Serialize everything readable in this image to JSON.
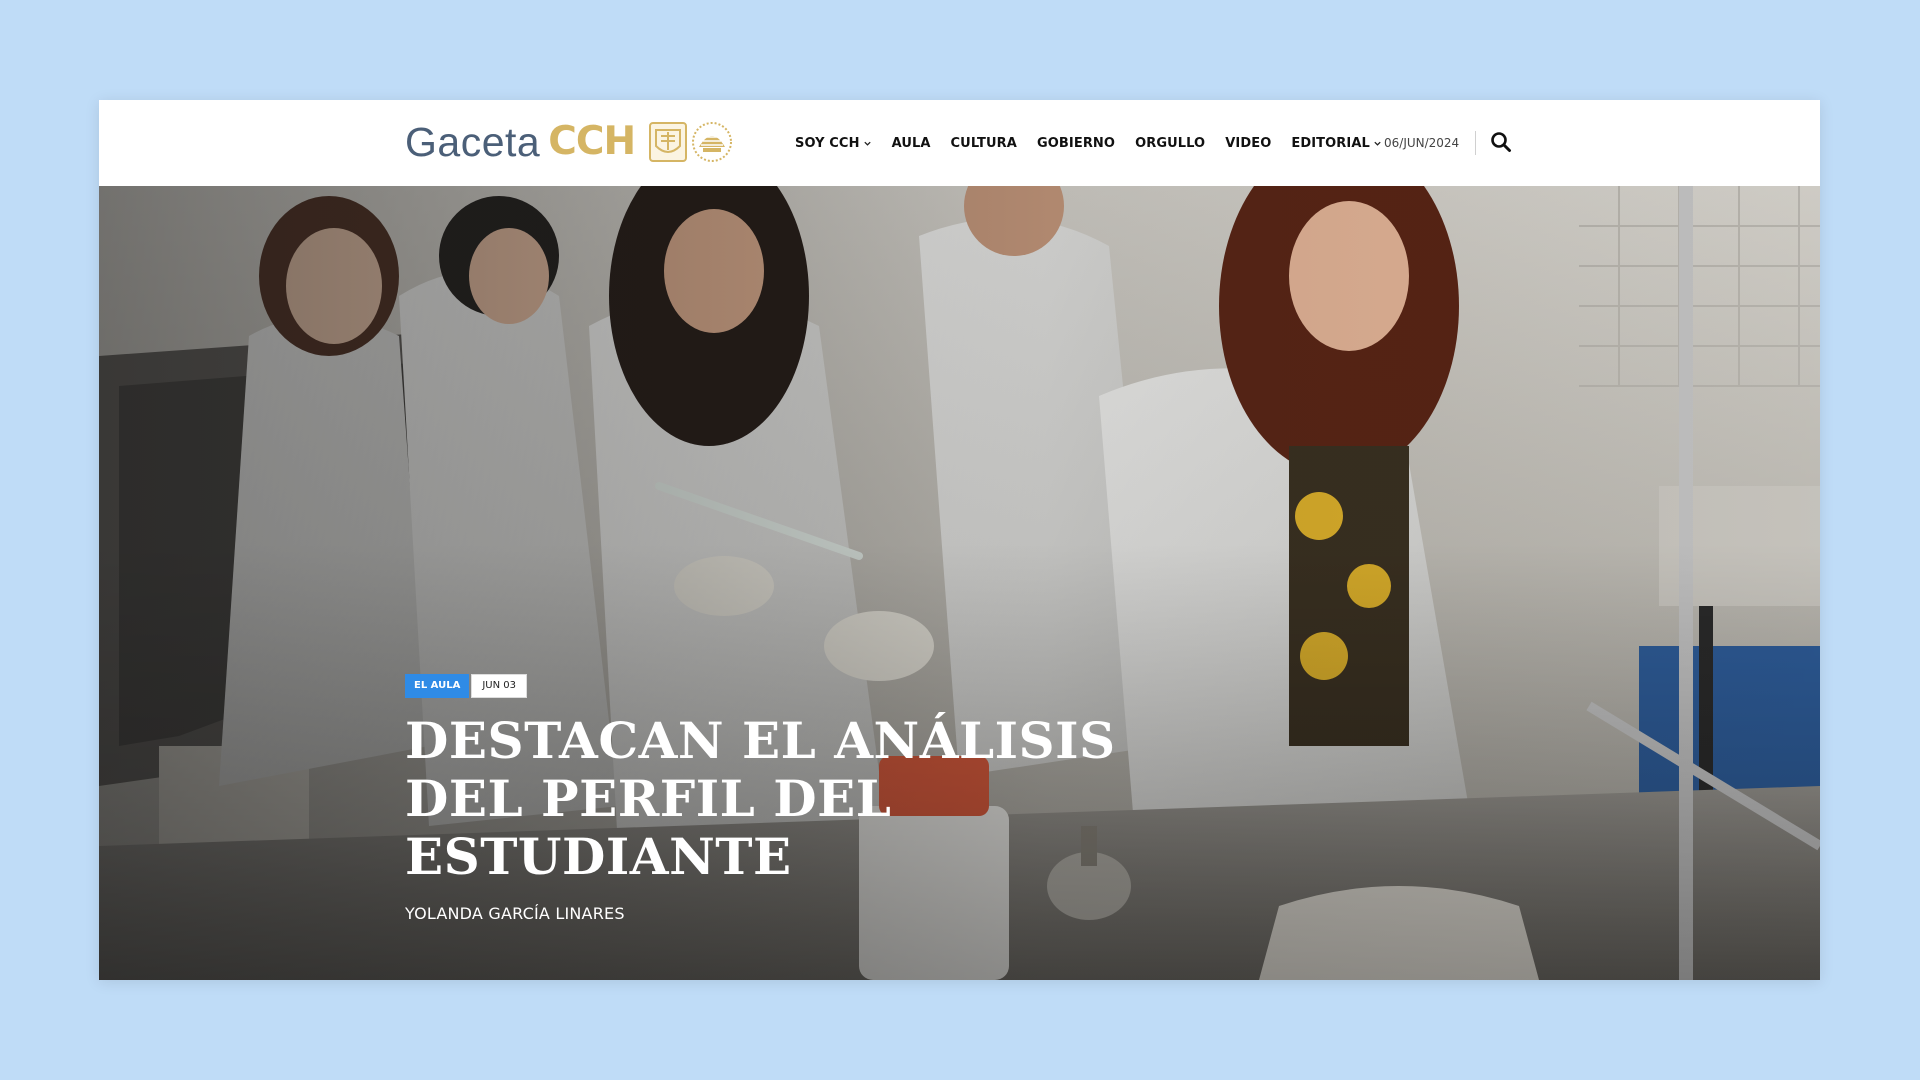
{
  "brand": {
    "word": "Gaceta",
    "mark": "CCH",
    "seal_icon": "unam-seal-icon",
    "emblem_icon": "cch-emblem-icon"
  },
  "nav": {
    "items": [
      {
        "label": "SOY CCH",
        "has_dropdown": true
      },
      {
        "label": "AULA",
        "has_dropdown": false
      },
      {
        "label": "CULTURA",
        "has_dropdown": false
      },
      {
        "label": "GOBIERNO",
        "has_dropdown": false
      },
      {
        "label": "ORGULLO",
        "has_dropdown": false
      },
      {
        "label": "VIDEO",
        "has_dropdown": false
      },
      {
        "label": "EDITORIAL",
        "has_dropdown": true
      }
    ],
    "date": "06/JUN/2024",
    "search_icon": "search-icon"
  },
  "hero": {
    "category": "EL AULA",
    "date": "JUN 03",
    "title": "DESTACAN EL ANÁLISIS DEL PERFIL DEL ESTUDIANTE",
    "author": "YOLANDA GARCÍA LINARES"
  },
  "colors": {
    "page_bg": "#bfdcf7",
    "brand_gray": "#4b5f78",
    "brand_gold": "#d5b564",
    "tag_blue": "#2f8be6"
  }
}
